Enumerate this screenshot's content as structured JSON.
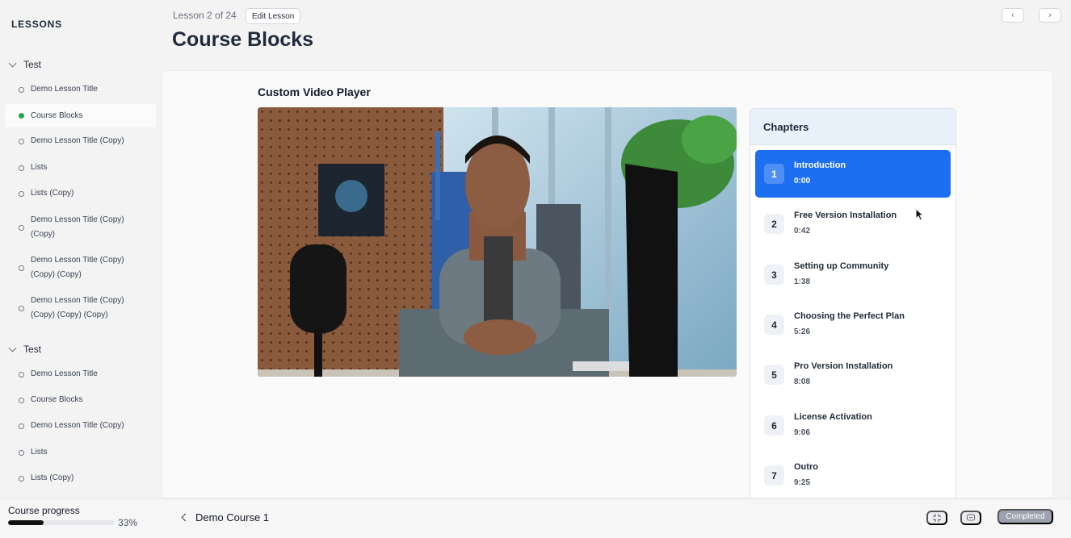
{
  "sidebar": {
    "title": "LESSONS",
    "groups": [
      {
        "title": "Test",
        "lessons": [
          {
            "label": "Demo Lesson Title",
            "done": false
          },
          {
            "label": "Course Blocks",
            "done": true
          },
          {
            "label": "Demo Lesson Title (Copy)",
            "done": false
          },
          {
            "label": "Lists",
            "done": false
          },
          {
            "label": "Lists (Copy)",
            "done": false
          },
          {
            "label": "Demo Lesson Title (Copy) (Copy)",
            "done": false
          },
          {
            "label": "Demo Lesson Title (Copy) (Copy) (Copy)",
            "done": false
          },
          {
            "label": "Demo Lesson Title (Copy) (Copy) (Copy) (Copy)",
            "done": false
          }
        ]
      },
      {
        "title": "Test",
        "lessons": [
          {
            "label": "Demo Lesson Title",
            "done": false
          },
          {
            "label": "Course Blocks",
            "done": false
          },
          {
            "label": "Demo Lesson Title (Copy)",
            "done": false
          },
          {
            "label": "Lists",
            "done": false
          },
          {
            "label": "Lists (Copy)",
            "done": false
          }
        ]
      }
    ]
  },
  "header": {
    "lesson_position": "Lesson 2 of 24",
    "edit_label": "Edit Lesson",
    "title": "Course Blocks",
    "prev_icon": "chevron-left-icon",
    "next_icon": "chevron-right-icon"
  },
  "content": {
    "block_title": "Custom Video Player",
    "chapters_title": "Chapters",
    "active_chapter": 1,
    "chapters": [
      {
        "num": "1",
        "title": "Introduction",
        "time": "0:00"
      },
      {
        "num": "2",
        "title": "Free Version Installation",
        "time": "0:42"
      },
      {
        "num": "3",
        "title": "Setting up Community",
        "time": "1:38"
      },
      {
        "num": "4",
        "title": "Choosing the Perfect Plan",
        "time": "5:26"
      },
      {
        "num": "5",
        "title": "Pro Version Installation",
        "time": "8:08"
      },
      {
        "num": "6",
        "title": "License Activation",
        "time": "9:06"
      },
      {
        "num": "7",
        "title": "Outro",
        "time": "9:25"
      }
    ]
  },
  "footer": {
    "progress_label": "Course progress",
    "progress_percent": 33,
    "progress_text": "33%",
    "course_name": "Demo Course 1",
    "completed_label": "Completed",
    "focus_icon": "focus-icon",
    "chat_icon": "chat-icon"
  },
  "colors": {
    "accent": "#1d6ff2",
    "done": "#22a653",
    "completed_bg": "#9ca3af"
  }
}
